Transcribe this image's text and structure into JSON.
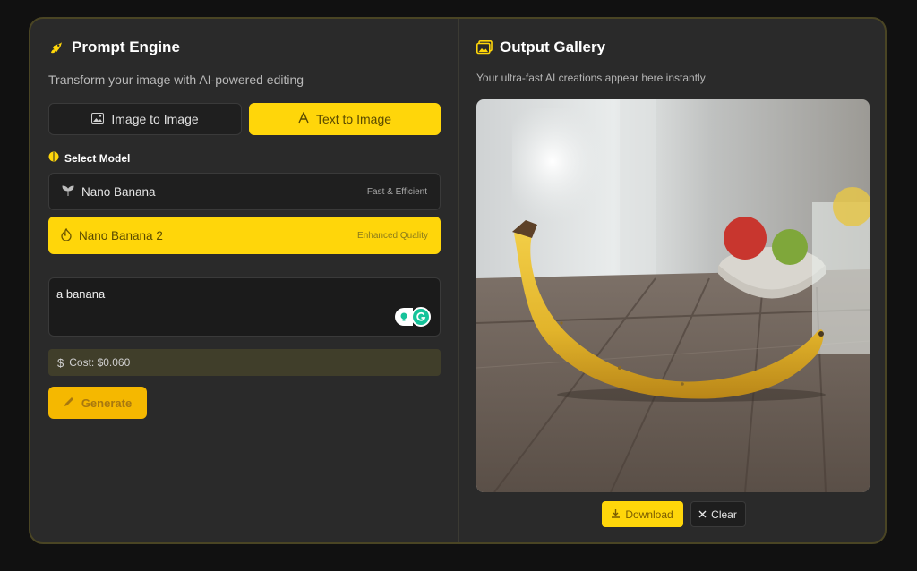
{
  "colors": {
    "accent": "#ffd60a",
    "panel": "#2a2a2a",
    "background": "#111111",
    "border": "#4a4524"
  },
  "prompt_engine": {
    "title": "Prompt Engine",
    "title_icon": "rocket-icon",
    "subtitle": "Transform your image with AI-powered editing",
    "modes": [
      {
        "label": "Image to Image",
        "icon": "image-icon",
        "active": false
      },
      {
        "label": "Text to Image",
        "icon": "text-icon",
        "active": true
      }
    ],
    "select_model_label": "Select Model",
    "models": [
      {
        "name": "Nano Banana",
        "tag": "Fast & Efficient",
        "icon": "sprout-icon",
        "selected": false
      },
      {
        "name": "Nano Banana 2",
        "tag": "Enhanced Quality",
        "icon": "flame-icon",
        "selected": true
      }
    ],
    "prompt_value": "a banana",
    "cost_label": "Cost: $0.060",
    "generate_label": "Generate"
  },
  "output_gallery": {
    "title": "Output Gallery",
    "title_icon": "gallery-icon",
    "subtitle": "Your ultra-fast AI creations appear here instantly",
    "image_subject": "banana on wooden table",
    "download_label": "Download",
    "clear_label": "Clear"
  }
}
